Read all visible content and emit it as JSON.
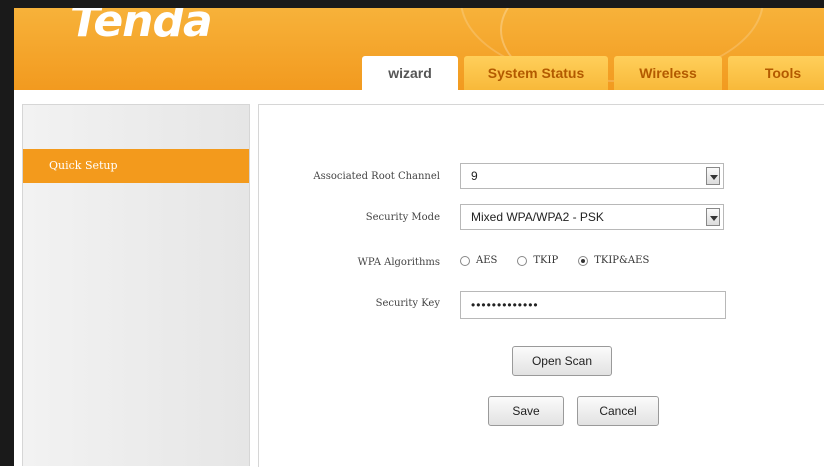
{
  "brand": {
    "logo_text": "Tenda"
  },
  "tabs": [
    {
      "label": "wizard",
      "active": true
    },
    {
      "label": "System Status",
      "active": false
    },
    {
      "label": "Wireless",
      "active": false
    },
    {
      "label": "Tools",
      "active": false
    }
  ],
  "sidebar": {
    "items": [
      {
        "label": "Quick Setup",
        "active": true
      }
    ]
  },
  "form": {
    "channel": {
      "label": "Associated Root Channel",
      "value": "9"
    },
    "security_mode": {
      "label": "Security Mode",
      "value": "Mixed WPA/WPA2 - PSK"
    },
    "wpa": {
      "label": "WPA Algorithms",
      "options": [
        {
          "label": "AES",
          "selected": false
        },
        {
          "label": "TKIP",
          "selected": false
        },
        {
          "label": "TKIP&AES",
          "selected": true
        }
      ]
    },
    "key": {
      "label": "Security Key",
      "value": "•••••••••••••"
    }
  },
  "buttons": {
    "open_scan": "Open Scan",
    "save": "Save",
    "cancel": "Cancel"
  },
  "colors": {
    "accent": "#f29a1f",
    "tab": "#f8b93a"
  }
}
